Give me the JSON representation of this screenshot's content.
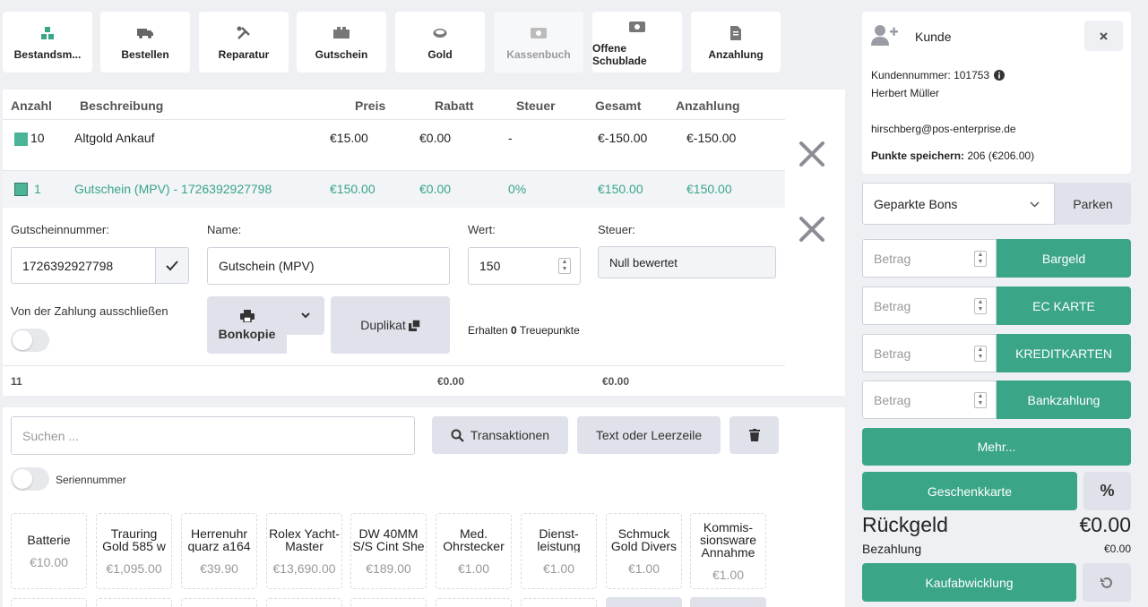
{
  "toolbar": [
    {
      "label": "Bestandsm...",
      "icon": "boxes-icon",
      "disabled": false
    },
    {
      "label": "Bestellen",
      "icon": "truck-icon",
      "disabled": false
    },
    {
      "label": "Reparatur",
      "icon": "tools-icon",
      "disabled": false
    },
    {
      "label": "Gutschein",
      "icon": "voucher-icon",
      "disabled": false
    },
    {
      "label": "Gold",
      "icon": "gold-icon",
      "disabled": false
    },
    {
      "label": "Kassenbuch",
      "icon": "cash-icon",
      "disabled": true
    },
    {
      "label": "Offene Schublade",
      "icon": "drawer-icon",
      "disabled": false
    },
    {
      "label": "Anzahlung",
      "icon": "document-icon",
      "disabled": false
    }
  ],
  "table": {
    "headers": [
      "Anzahl",
      "Beschreibung",
      "Preis",
      "Rabatt",
      "Steuer",
      "Gesamt",
      "Anzahlung"
    ],
    "rows": [
      {
        "qty": "10",
        "desc": "Altgold Ankauf",
        "price": "€15.00",
        "discount": "€0.00",
        "tax": "-",
        "total": "€-150.00",
        "deposit": "€-150.00"
      },
      {
        "qty": "1",
        "desc": "Gutschein (MPV) - 1726392927798",
        "price": "€150.00",
        "discount": "€0.00",
        "tax": "0%",
        "total": "€150.00",
        "deposit": "€150.00"
      }
    ],
    "footer": {
      "qty": "11",
      "discount": "€0.00",
      "total": "€0.00"
    }
  },
  "detail": {
    "voucher_label": "Gutscheinnummer:",
    "voucher_value": "1726392927798",
    "name_label": "Name:",
    "name_value": "Gutschein (MPV)",
    "value_label": "Wert:",
    "value_value": "150",
    "tax_label": "Steuer:",
    "tax_value": "Null bewertet",
    "exclude_label": "Von der Zahlung ausschließen",
    "receipt_copy": "Bonkopie",
    "duplicate": "Duplikat",
    "points_prefix": "Erhalten",
    "points_value": "0",
    "points_suffix": "Treuepunkte"
  },
  "search": {
    "placeholder": "Suchen ...",
    "transactions": "Transaktionen",
    "text_line": "Text oder Leerzeile",
    "serial_label": "Seriennummer"
  },
  "products": [
    {
      "name": "Batterie",
      "price": "€10.00"
    },
    {
      "name": "Trauring Gold 585 w",
      "price": "€1,095.00"
    },
    {
      "name": "Herrenuhr quarz a164",
      "price": "€39.90"
    },
    {
      "name": "Rolex Yacht-Master",
      "price": "€13,690.00"
    },
    {
      "name": "DW 40MM S/S Cint She",
      "price": "€189.00"
    },
    {
      "name": "Med. Ohrstecker",
      "price": "€1.00"
    },
    {
      "name": "Dienst-leistung",
      "price": "€1.00"
    },
    {
      "name": "Schmuck Gold Divers",
      "price": "€1.00"
    },
    {
      "name": "Kommis-sionsware Annahme",
      "price": "€1.00"
    }
  ],
  "customer": {
    "title": "Kunde",
    "number_label": "Kundennummer:",
    "number": "101753",
    "name": "Herbert Müller",
    "email": "hirschberg@pos-enterprise.de",
    "points_label": "Punkte speichern:",
    "points": "206 (€206.00)"
  },
  "parked": {
    "select": "Geparkte Bons",
    "park": "Parken"
  },
  "payments": [
    {
      "placeholder": "Betrag",
      "label": "Bargeld"
    },
    {
      "placeholder": "Betrag",
      "label": "EC KARTE"
    },
    {
      "placeholder": "Betrag",
      "label": "KREDITKARTEN"
    },
    {
      "placeholder": "Betrag",
      "label": "Bankzahlung"
    }
  ],
  "more": "Mehr...",
  "giftcard": "Geschenkkarte",
  "percent": "%",
  "change_label": "Rückgeld",
  "change_value": "€0.00",
  "payment_label": "Bezahlung",
  "payment_value": "€0.00",
  "checkout": "Kaufabwicklung",
  "colors": {
    "accent": "#3aa587",
    "bg": "#eef0f4"
  }
}
